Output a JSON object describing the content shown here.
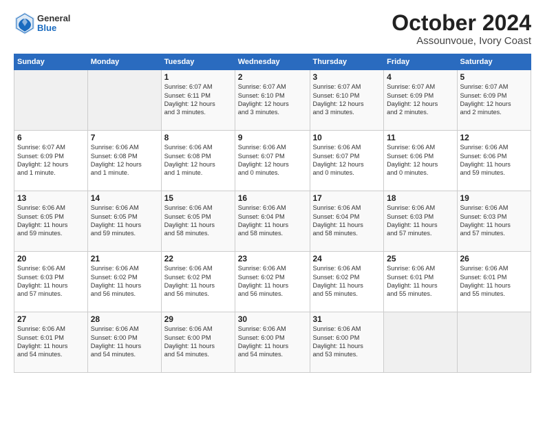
{
  "logo": {
    "general": "General",
    "blue": "Blue"
  },
  "header": {
    "month": "October 2024",
    "location": "Assounvoue, Ivory Coast"
  },
  "weekdays": [
    "Sunday",
    "Monday",
    "Tuesday",
    "Wednesday",
    "Thursday",
    "Friday",
    "Saturday"
  ],
  "weeks": [
    [
      {
        "day": "",
        "info": ""
      },
      {
        "day": "",
        "info": ""
      },
      {
        "day": "1",
        "info": "Sunrise: 6:07 AM\nSunset: 6:11 PM\nDaylight: 12 hours\nand 3 minutes."
      },
      {
        "day": "2",
        "info": "Sunrise: 6:07 AM\nSunset: 6:10 PM\nDaylight: 12 hours\nand 3 minutes."
      },
      {
        "day": "3",
        "info": "Sunrise: 6:07 AM\nSunset: 6:10 PM\nDaylight: 12 hours\nand 3 minutes."
      },
      {
        "day": "4",
        "info": "Sunrise: 6:07 AM\nSunset: 6:09 PM\nDaylight: 12 hours\nand 2 minutes."
      },
      {
        "day": "5",
        "info": "Sunrise: 6:07 AM\nSunset: 6:09 PM\nDaylight: 12 hours\nand 2 minutes."
      }
    ],
    [
      {
        "day": "6",
        "info": "Sunrise: 6:07 AM\nSunset: 6:09 PM\nDaylight: 12 hours\nand 1 minute."
      },
      {
        "day": "7",
        "info": "Sunrise: 6:06 AM\nSunset: 6:08 PM\nDaylight: 12 hours\nand 1 minute."
      },
      {
        "day": "8",
        "info": "Sunrise: 6:06 AM\nSunset: 6:08 PM\nDaylight: 12 hours\nand 1 minute."
      },
      {
        "day": "9",
        "info": "Sunrise: 6:06 AM\nSunset: 6:07 PM\nDaylight: 12 hours\nand 0 minutes."
      },
      {
        "day": "10",
        "info": "Sunrise: 6:06 AM\nSunset: 6:07 PM\nDaylight: 12 hours\nand 0 minutes."
      },
      {
        "day": "11",
        "info": "Sunrise: 6:06 AM\nSunset: 6:06 PM\nDaylight: 12 hours\nand 0 minutes."
      },
      {
        "day": "12",
        "info": "Sunrise: 6:06 AM\nSunset: 6:06 PM\nDaylight: 11 hours\nand 59 minutes."
      }
    ],
    [
      {
        "day": "13",
        "info": "Sunrise: 6:06 AM\nSunset: 6:05 PM\nDaylight: 11 hours\nand 59 minutes."
      },
      {
        "day": "14",
        "info": "Sunrise: 6:06 AM\nSunset: 6:05 PM\nDaylight: 11 hours\nand 59 minutes."
      },
      {
        "day": "15",
        "info": "Sunrise: 6:06 AM\nSunset: 6:05 PM\nDaylight: 11 hours\nand 58 minutes."
      },
      {
        "day": "16",
        "info": "Sunrise: 6:06 AM\nSunset: 6:04 PM\nDaylight: 11 hours\nand 58 minutes."
      },
      {
        "day": "17",
        "info": "Sunrise: 6:06 AM\nSunset: 6:04 PM\nDaylight: 11 hours\nand 58 minutes."
      },
      {
        "day": "18",
        "info": "Sunrise: 6:06 AM\nSunset: 6:03 PM\nDaylight: 11 hours\nand 57 minutes."
      },
      {
        "day": "19",
        "info": "Sunrise: 6:06 AM\nSunset: 6:03 PM\nDaylight: 11 hours\nand 57 minutes."
      }
    ],
    [
      {
        "day": "20",
        "info": "Sunrise: 6:06 AM\nSunset: 6:03 PM\nDaylight: 11 hours\nand 57 minutes."
      },
      {
        "day": "21",
        "info": "Sunrise: 6:06 AM\nSunset: 6:02 PM\nDaylight: 11 hours\nand 56 minutes."
      },
      {
        "day": "22",
        "info": "Sunrise: 6:06 AM\nSunset: 6:02 PM\nDaylight: 11 hours\nand 56 minutes."
      },
      {
        "day": "23",
        "info": "Sunrise: 6:06 AM\nSunset: 6:02 PM\nDaylight: 11 hours\nand 56 minutes."
      },
      {
        "day": "24",
        "info": "Sunrise: 6:06 AM\nSunset: 6:02 PM\nDaylight: 11 hours\nand 55 minutes."
      },
      {
        "day": "25",
        "info": "Sunrise: 6:06 AM\nSunset: 6:01 PM\nDaylight: 11 hours\nand 55 minutes."
      },
      {
        "day": "26",
        "info": "Sunrise: 6:06 AM\nSunset: 6:01 PM\nDaylight: 11 hours\nand 55 minutes."
      }
    ],
    [
      {
        "day": "27",
        "info": "Sunrise: 6:06 AM\nSunset: 6:01 PM\nDaylight: 11 hours\nand 54 minutes."
      },
      {
        "day": "28",
        "info": "Sunrise: 6:06 AM\nSunset: 6:00 PM\nDaylight: 11 hours\nand 54 minutes."
      },
      {
        "day": "29",
        "info": "Sunrise: 6:06 AM\nSunset: 6:00 PM\nDaylight: 11 hours\nand 54 minutes."
      },
      {
        "day": "30",
        "info": "Sunrise: 6:06 AM\nSunset: 6:00 PM\nDaylight: 11 hours\nand 54 minutes."
      },
      {
        "day": "31",
        "info": "Sunrise: 6:06 AM\nSunset: 6:00 PM\nDaylight: 11 hours\nand 53 minutes."
      },
      {
        "day": "",
        "info": ""
      },
      {
        "day": "",
        "info": ""
      }
    ]
  ]
}
